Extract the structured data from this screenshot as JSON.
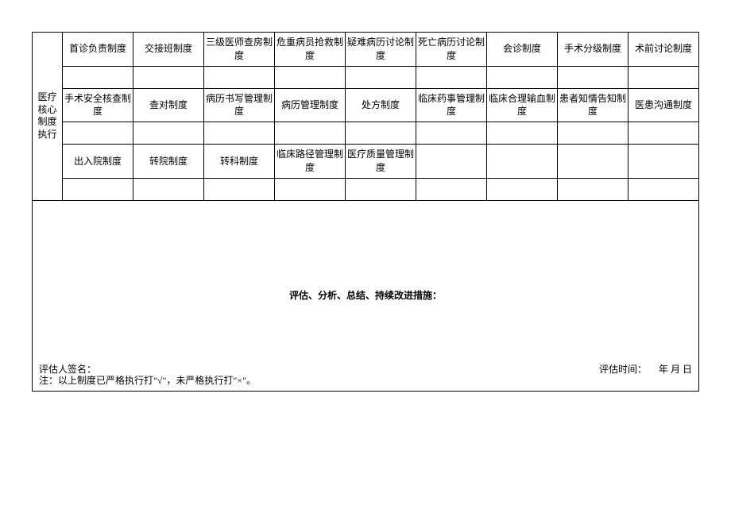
{
  "rowHeader": "医疗核心制度执行",
  "row1": [
    "首诊负责制度",
    "交接班制度",
    "三级医师查房制度",
    "危重病员抢救制度",
    "疑难病历讨论制度",
    "死亡病历讨论制度",
    "会诊制度",
    "手术分级制度",
    "术前讨论制度"
  ],
  "row2": [
    "手术安全核查制度",
    "查对制度",
    "病历书写管理制度",
    "病历管理制度",
    "处方制度",
    "临床药事管理制度",
    "临床合理输血制度",
    "患者知情告知制度",
    "医患沟通制度"
  ],
  "row3": [
    "出入院制度",
    "转院制度",
    "转科制度",
    "临床路径管理制度",
    "医疗质量管理制度",
    "",
    "",
    "",
    ""
  ],
  "assessmentTitle": "评估、分析、总结、持续改进措施：",
  "signatureLabel": "评估人签名：",
  "timeLabel": "评估时间：",
  "timeValue": "年  月  日",
  "footerNote": "注：以上制度已严格执行打\"√\"，未严格执行打\"×\"。"
}
